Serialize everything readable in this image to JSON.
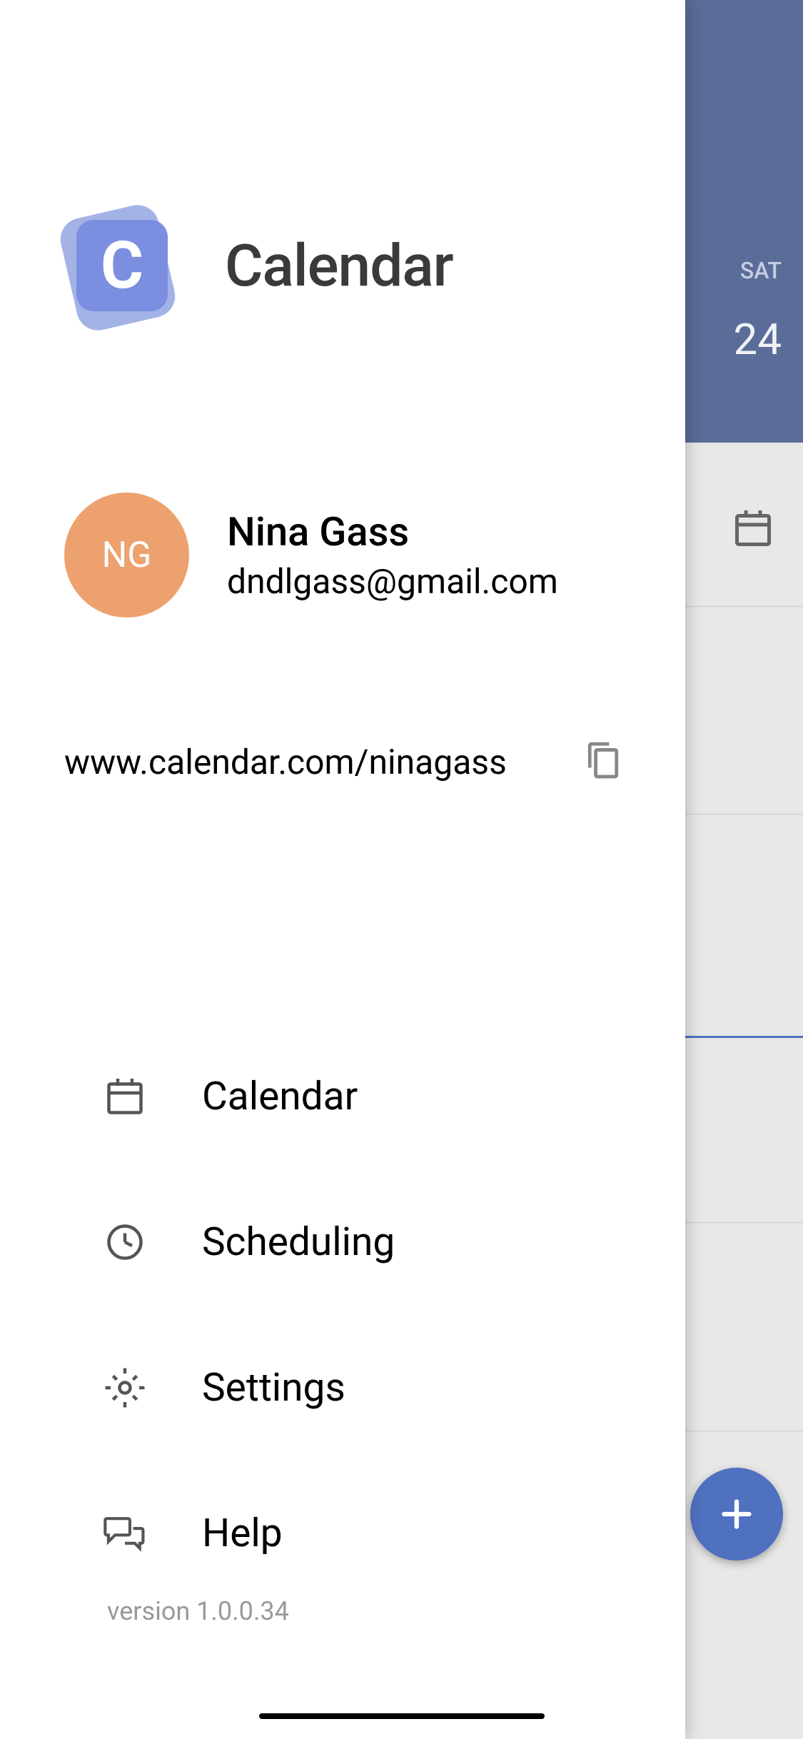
{
  "app": {
    "name": "Calendar"
  },
  "profile": {
    "initials": "NG",
    "name": "Nina Gass",
    "email": "dndlgass@gmail.com",
    "share_url": "www.calendar.com/ninagass"
  },
  "nav": {
    "items": [
      {
        "label": "Calendar"
      },
      {
        "label": "Scheduling"
      },
      {
        "label": "Settings"
      },
      {
        "label": "Help"
      }
    ]
  },
  "version": "version 1.0.0.34",
  "background": {
    "day_label": "SAT",
    "day_number": "24"
  }
}
